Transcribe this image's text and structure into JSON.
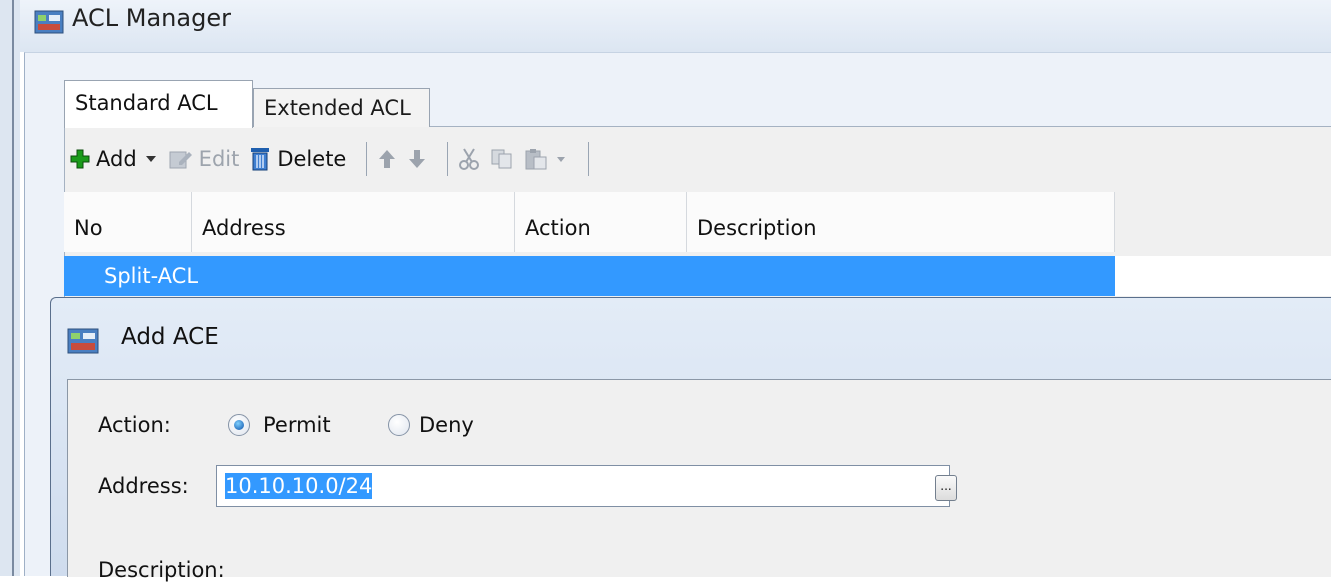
{
  "window": {
    "title": "ACL Manager"
  },
  "tabs": [
    {
      "label": "Standard ACL",
      "active": true
    },
    {
      "label": "Extended ACL",
      "active": false
    }
  ],
  "toolbar": {
    "add_label": "Add",
    "edit_label": "Edit",
    "delete_label": "Delete"
  },
  "table": {
    "columns": [
      "No",
      "Address",
      "Action",
      "Description"
    ],
    "selected_row": "Split-ACL"
  },
  "dialog": {
    "title": "Add ACE",
    "action_label": "Action:",
    "permit_label": "Permit",
    "deny_label": "Deny",
    "selected_action": "Permit",
    "address_label": "Address:",
    "address_value": "10.10.10.0/24",
    "browse_label": "...",
    "description_label": "Description:"
  },
  "colors": {
    "selection": "#3399ff",
    "add_icon": "#1a9a1a"
  }
}
